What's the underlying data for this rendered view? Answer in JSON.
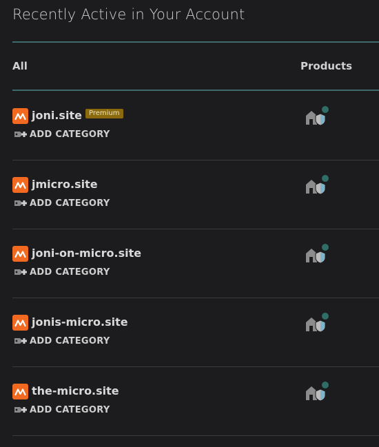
{
  "page": {
    "title": "Recently Active in Your Account"
  },
  "columns": {
    "all": "All",
    "products": "Products"
  },
  "rows": [
    {
      "name": "joni.site",
      "badge": "Premium",
      "add_category": "ADD CATEGORY"
    },
    {
      "name": "jmicro.site",
      "badge": "",
      "add_category": "ADD CATEGORY"
    },
    {
      "name": "joni-on-micro.site",
      "badge": "",
      "add_category": "ADD CATEGORY"
    },
    {
      "name": "jonis-micro.site",
      "badge": "",
      "add_category": "ADD CATEGORY"
    },
    {
      "name": "the-micro.site",
      "badge": "",
      "add_category": "ADD CATEGORY"
    }
  ],
  "icons": {
    "site_logo": "site-logo-icon",
    "add_category": "tag-plus-icon",
    "product": "house-shield-icon"
  },
  "colors": {
    "background": "#1c1c1e",
    "accent_rule": "#3e6a6d",
    "logo": "#f26a22",
    "premium_badge": "#8a6a0c"
  }
}
